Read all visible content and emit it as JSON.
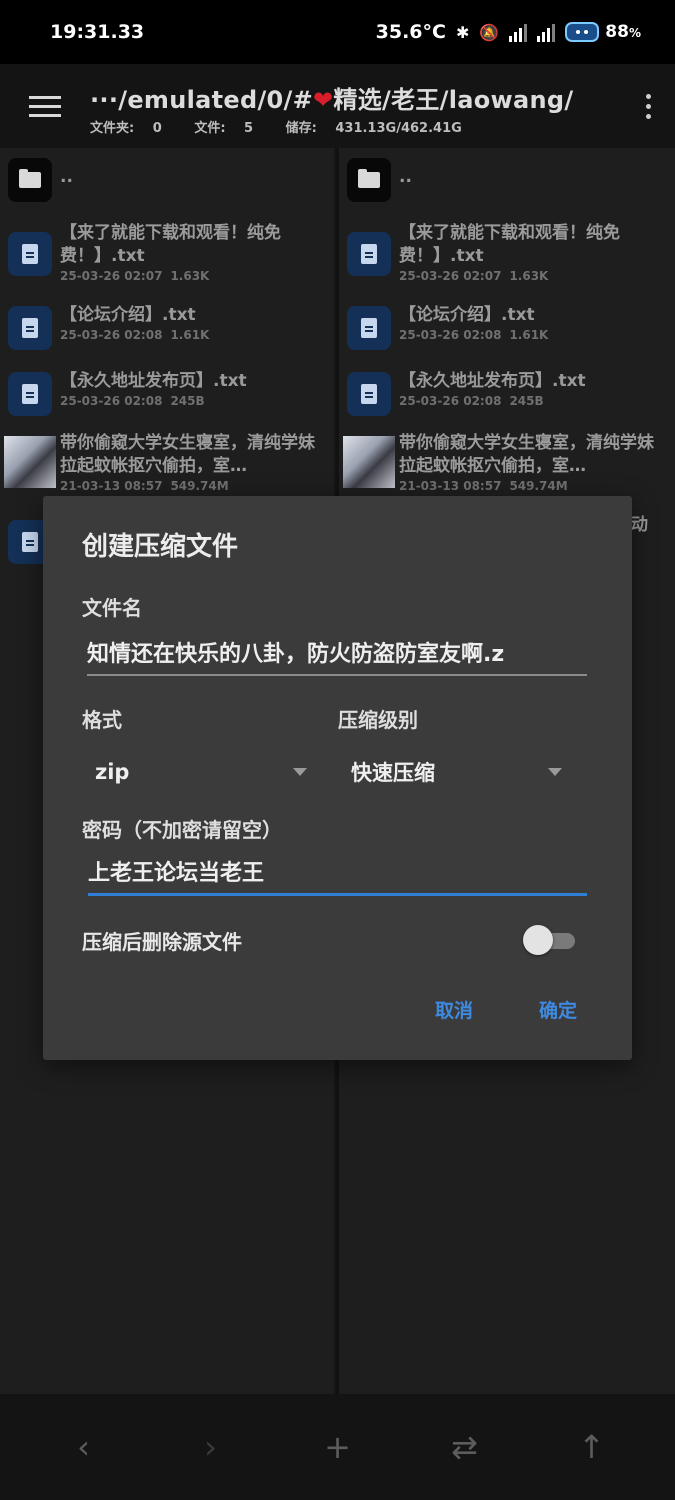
{
  "status_bar": {
    "time": "19:31.33",
    "temperature": "35.6°C",
    "network_a": "4G",
    "network_b": "4G",
    "battery_pct": "88",
    "battery_unit": "%"
  },
  "app_bar": {
    "path_prefix": "···/emulated/0/#",
    "path_heart": "❤",
    "path_suffix": "精选/老王/laowang/",
    "folders_label": "文件夹:",
    "folders_count": "0",
    "files_label": "文件:",
    "files_count": "5",
    "storage_label": "储存:",
    "storage_value": "431.13G/462.41G"
  },
  "file_list": [
    {
      "type": "folder",
      "name": ".."
    },
    {
      "type": "doc",
      "name": "【来了就能下载和观看！纯免费！】.txt",
      "date": "25-03-26 02:07",
      "size": "1.63K"
    },
    {
      "type": "doc",
      "name": "【论坛介绍】.txt",
      "date": "25-03-26 02:08",
      "size": "1.61K"
    },
    {
      "type": "doc",
      "name": "【永久地址发布页】.txt",
      "date": "25-03-26 02:08",
      "size": "245B"
    },
    {
      "type": "video",
      "name": "带你偷窥大学女生寝室，清纯学妹拉起蚊帐抠穴偷拍，室…",
      "date": "21-03-13 08:57",
      "size": "549.74M"
    }
  ],
  "partial_item_tail": "动",
  "dialog": {
    "title": "创建压缩文件",
    "filename_label": "文件名",
    "filename_value": "知情还在快乐的八卦，防火防盗防室友啊.z",
    "format_label": "格式",
    "format_value": "zip",
    "level_label": "压缩级别",
    "level_value": "快速压缩",
    "password_label": "密码（不加密请留空）",
    "password_value": "上老王论坛当老王",
    "delete_label": "压缩后删除源文件",
    "delete_enabled": false,
    "cancel": "取消",
    "ok": "确定"
  },
  "toolbar": {
    "back": "‹",
    "forward": "›",
    "add": "+",
    "swap": "⇄",
    "up": "↑"
  }
}
